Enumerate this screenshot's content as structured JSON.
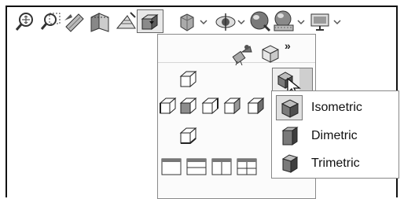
{
  "toolbar": {
    "icons": [
      "zoom-to-fit-icon",
      "zoom-to-area-icon",
      "previous-view-icon",
      "section-view-icon",
      "dynamic-annotation-icon",
      "view-orientation-icon",
      "display-style-icon",
      "hide-show-icon",
      "edit-appearance-icon",
      "apply-scene-icon",
      "view-settings-icon"
    ]
  },
  "view_orientation_menu": {
    "overflow_glyph": "»",
    "icons": [
      "camera-icon",
      "view-selector-icon",
      "top-view-icon",
      "left-view-icon",
      "front-view-icon",
      "right-view-icon",
      "back-view-icon",
      "bottom-view-icon",
      "single-view-icon",
      "two-view-horizontal-icon",
      "two-view-vertical-icon",
      "four-view-icon",
      "isometric-view-icon"
    ]
  },
  "view_submenu": {
    "items": [
      {
        "label": "Isometric",
        "icon": "isometric-icon",
        "selected": true
      },
      {
        "label": "Dimetric",
        "icon": "dimetric-icon",
        "selected": false
      },
      {
        "label": "Trimetric",
        "icon": "trimetric-icon",
        "selected": false
      }
    ]
  },
  "colors": {
    "frame": "#111111",
    "menu_bg": "#fbfbfb",
    "highlight": "#9fc3ff"
  }
}
